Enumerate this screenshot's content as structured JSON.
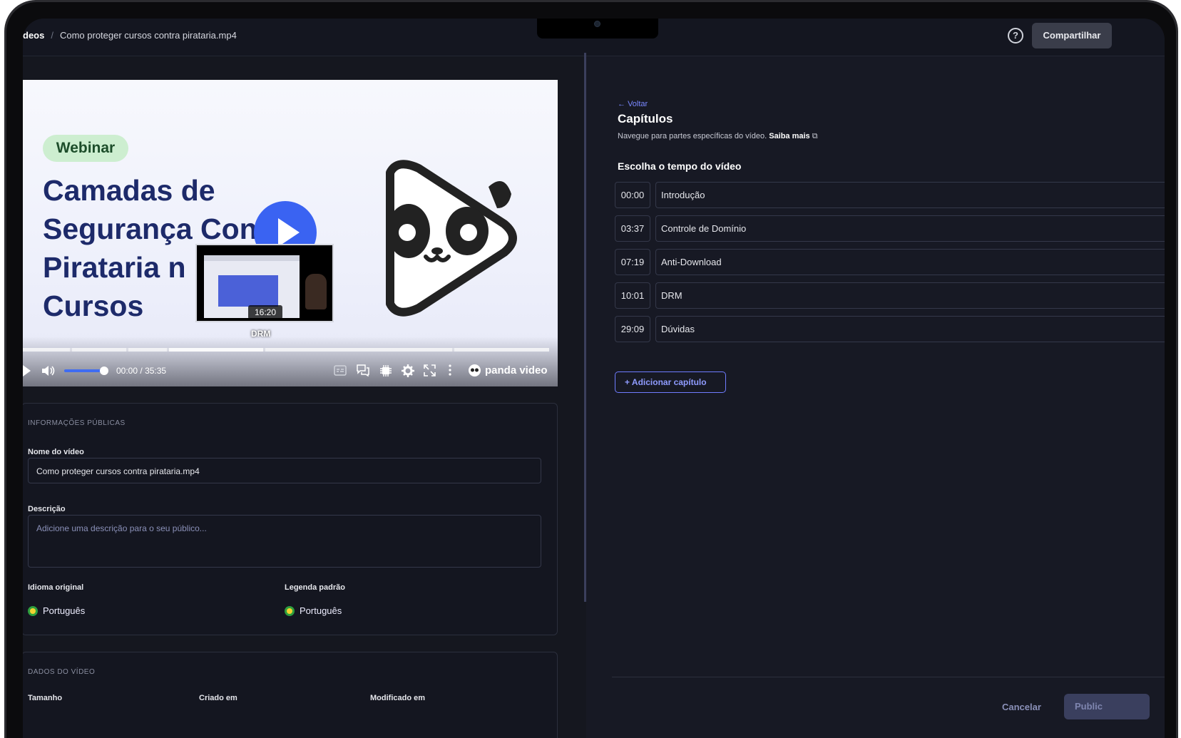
{
  "header": {
    "breadcrumb_parent": "deos",
    "breadcrumb_current": "Como proteger cursos contra pirataria.mp4",
    "share_label": "Compartilhar",
    "help_glyph": "?"
  },
  "video": {
    "badge": "Webinar",
    "headline": [
      "Camadas de",
      "Segurança Contra",
      "Pirataria n",
      "Cursos"
    ],
    "preview_time": "16:20",
    "preview_chapter": "DRM",
    "current_time": "00:00",
    "time_sep": "/",
    "duration": "35:35",
    "brand": "panda video",
    "played_fraction": 0.0,
    "volume_fraction": 0.75
  },
  "public_info": {
    "section": "INFORMAÇÕES PÚBLICAS",
    "name_label": "Nome do vídeo",
    "name_value": "Como proteger cursos contra pirataria.mp4",
    "desc_label": "Descrição",
    "desc_placeholder": "Adicione uma descrição para o seu público...",
    "lang_label": "Idioma original",
    "lang_value": "Português",
    "subtitle_label": "Legenda padrão",
    "subtitle_value": "Português"
  },
  "video_data": {
    "section": "DADOS DO VÍDEO",
    "size_label": "Tamanho",
    "created_label": "Criado em",
    "modified_label": "Modificado em"
  },
  "chapters": {
    "back_label": "Voltar",
    "title": "Capítulos",
    "subtitle": "Navegue para partes específicas do vídeo.",
    "learn_more": "Saiba mais",
    "pick_time": "Escolha o tempo do vídeo",
    "items": [
      {
        "time": "00:00",
        "name": "Introdução"
      },
      {
        "time": "03:37",
        "name": "Controle de Domínio"
      },
      {
        "time": "07:19",
        "name": "Anti-Download"
      },
      {
        "time": "10:01",
        "name": "DRM"
      },
      {
        "time": "29:09",
        "name": "Dúvidas"
      }
    ],
    "add_label": "Adicionar capítulo",
    "cancel_label": "Cancelar",
    "publish_label": "Public"
  },
  "colors": {
    "accent": "#3f6cf2",
    "link": "#7a88ff",
    "headline": "#1d2a6a"
  },
  "icons": [
    "help-icon",
    "arrow-left-icon",
    "external-link-icon",
    "plus-icon",
    "play-icon",
    "volume-icon",
    "captions-icon",
    "chat-icon",
    "chip-icon",
    "gear-icon",
    "fullscreen-icon",
    "more-icon",
    "panda-logo-icon"
  ]
}
